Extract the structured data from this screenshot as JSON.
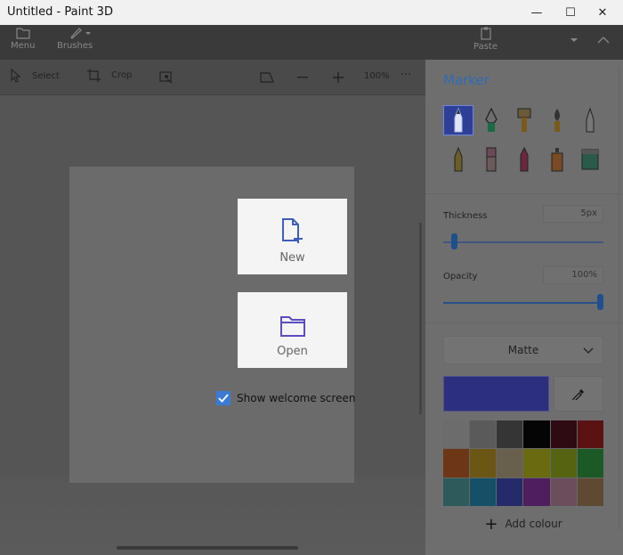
{
  "window": {
    "title": "Untitled - Paint 3D",
    "minimize_icon": "—",
    "maximize_icon": "☐",
    "close_icon": "✕"
  },
  "ribbon": {
    "menu_label": "Menu",
    "brushes_label": "Brushes",
    "paste_label": "Paste"
  },
  "toolbar": {
    "select_label": "Select",
    "crop_label": "Crop",
    "zoom_level": "100%",
    "more_icon": "···"
  },
  "welcome": {
    "new_label": "New",
    "open_label": "Open",
    "show_welcome_label": "Show welcome screen",
    "show_welcome_checked": true
  },
  "panel": {
    "title": "Marker",
    "brushes": [
      "marker-icon",
      "calligraphy-pen-icon",
      "oil-brush-icon",
      "watercolor-icon",
      "pixel-pen-icon",
      "pencil-icon",
      "eraser-icon",
      "crayon-icon",
      "spray-can-icon",
      "fill-bucket-icon"
    ],
    "thickness_label": "Thickness",
    "thickness_value": "5px",
    "thickness_fraction": 0.05,
    "opacity_label": "Opacity",
    "opacity_value": "100%",
    "opacity_fraction": 1.0,
    "finish_value": "Matte",
    "current_color": "#2c2e7e",
    "add_colour_label": "Add colour",
    "palette": [
      "#6c6c6c",
      "#5a5a5a",
      "#353535",
      "#050505",
      "#2e0a12",
      "#5a1212",
      "#6d3616",
      "#6b5616",
      "#68604c",
      "#6a6a10",
      "#566412",
      "#1b5a26",
      "#2d5a5a",
      "#155068",
      "#252a6a",
      "#4e1e5e",
      "#6a4e5c",
      "#5e4a32"
    ]
  }
}
